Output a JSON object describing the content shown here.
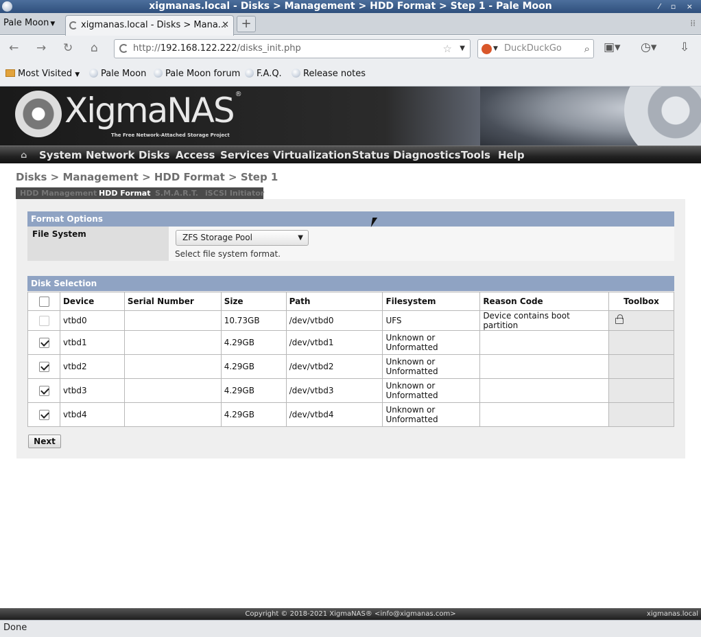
{
  "window": {
    "title": "xigmanas.local - Disks > Management > HDD Format > Step 1 - Pale Moon"
  },
  "browser": {
    "app_menu_label": "Pale Moon",
    "tab_title": "xigmanas.local - Disks > Mana...",
    "url_prefix": "http://",
    "url_host": "192.168.122.222",
    "url_path": "/disks_init.php",
    "search_placeholder": "DuckDuckGo",
    "bookmarks": [
      "Most Visited",
      "Pale Moon",
      "Pale Moon forum",
      "F.A.Q.",
      "Release notes"
    ],
    "status_text": "Done"
  },
  "header": {
    "logo_text": "XigmaNAS",
    "logo_reg": "®",
    "tagline": "The Free Network-Attached Storage Project"
  },
  "menu": {
    "home_icon": "⌂",
    "items": [
      "System",
      "Network",
      "Disks",
      "Access",
      "Services",
      "Virtualization",
      "Status",
      "Diagnostics",
      "Tools",
      "Help"
    ]
  },
  "breadcrumb": "Disks > Management > HDD Format > Step 1",
  "subtabs": [
    {
      "label": "HDD Management",
      "active": false
    },
    {
      "label": "HDD Format",
      "active": true
    },
    {
      "label": "S.M.A.R.T.",
      "active": false
    },
    {
      "label": "iSCSI Initiator",
      "active": false
    }
  ],
  "format_options": {
    "section_title": "Format Options",
    "file_system_label": "File System",
    "file_system_value": "ZFS Storage Pool",
    "file_system_hint": "Select file system format."
  },
  "disk_selection": {
    "section_title": "Disk Selection",
    "columns": [
      "Device",
      "Serial Number",
      "Size",
      "Path",
      "Filesystem",
      "Reason Code",
      "Toolbox"
    ],
    "rows": [
      {
        "checked": false,
        "disabled": true,
        "device": "vtbd0",
        "serial": "",
        "size": "10.73GB",
        "path": "/dev/vtbd0",
        "filesystem": "UFS",
        "reason": "Device contains boot partition",
        "locked": true
      },
      {
        "checked": true,
        "disabled": false,
        "device": "vtbd1",
        "serial": "",
        "size": "4.29GB",
        "path": "/dev/vtbd1",
        "filesystem": "Unknown or Unformatted",
        "reason": "",
        "locked": false
      },
      {
        "checked": true,
        "disabled": false,
        "device": "vtbd2",
        "serial": "",
        "size": "4.29GB",
        "path": "/dev/vtbd2",
        "filesystem": "Unknown or Unformatted",
        "reason": "",
        "locked": false
      },
      {
        "checked": true,
        "disabled": false,
        "device": "vtbd3",
        "serial": "",
        "size": "4.29GB",
        "path": "/dev/vtbd3",
        "filesystem": "Unknown or Unformatted",
        "reason": "",
        "locked": false
      },
      {
        "checked": true,
        "disabled": false,
        "device": "vtbd4",
        "serial": "",
        "size": "4.29GB",
        "path": "/dev/vtbd4",
        "filesystem": "Unknown or Unformatted",
        "reason": "",
        "locked": false
      }
    ]
  },
  "next_button_label": "Next",
  "footer": {
    "copyright": "Copyright © 2018-2021 XigmaNAS® <info@xigmanas.com>",
    "hostname": "xigmanas.local"
  },
  "colors": {
    "section_header": "#8fa3c3",
    "menu_bar": "#222222",
    "title_bar": "#3d5f8c"
  }
}
